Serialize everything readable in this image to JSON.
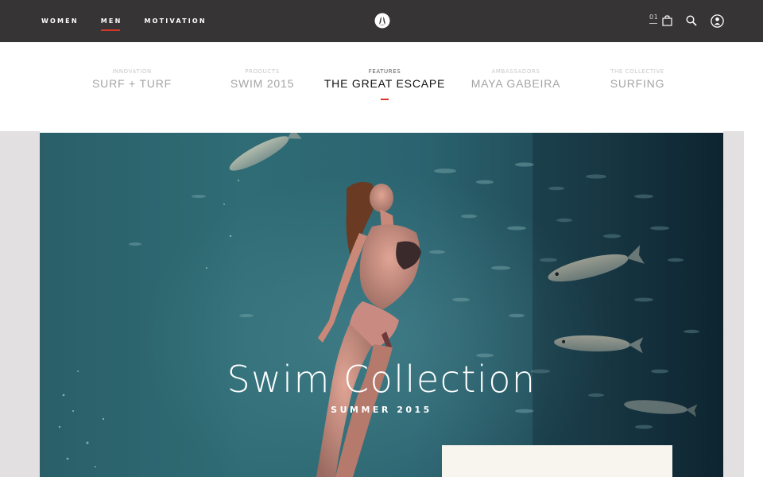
{
  "topbar": {
    "nav": [
      {
        "label": "WOMEN",
        "active": false
      },
      {
        "label": "MEN",
        "active": true
      },
      {
        "label": "MOTIVATION",
        "active": false
      }
    ],
    "cart_count": "01",
    "icons": [
      "lululemon-logo-icon",
      "shopping-bag-icon",
      "search-icon",
      "account-icon"
    ]
  },
  "catnav": {
    "items": [
      {
        "kicker": "INNOVATION",
        "title": "SURF + TURF",
        "active": false
      },
      {
        "kicker": "PRODUCTS",
        "title": "SWIM 2015",
        "active": false
      },
      {
        "kicker": "FEATURES",
        "title": "THE GREAT ESCAPE",
        "active": true
      },
      {
        "kicker": "AMBASSADORS",
        "title": "MAYA GABEIRA",
        "active": false
      },
      {
        "kicker": "THE COLLECTIVE",
        "title": "SURFING",
        "active": false
      }
    ]
  },
  "hero": {
    "title": "Swim Collection",
    "subtitle": "SUMMER 2015"
  },
  "colors": {
    "topbar": "#363435",
    "accent": "#d6372b",
    "water": "#2f6c75",
    "gutter": "#e2e0e1"
  }
}
